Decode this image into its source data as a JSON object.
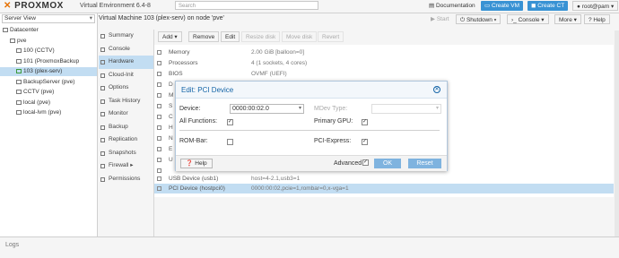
{
  "header": {
    "logo": "PROXMOX",
    "version": "Virtual Environment 6.4-8",
    "search_placeholder": "Search",
    "documentation": "Documentation",
    "create_vm": "Create VM",
    "create_ct": "Create CT",
    "user": "root@pam"
  },
  "tree": {
    "view": "Server View",
    "items": [
      {
        "label": "Datacenter"
      },
      {
        "label": "pve"
      },
      {
        "label": "100 (CCTV)"
      },
      {
        "label": "101 (ProxmoxBackup"
      },
      {
        "label": "103 (plex-serv)"
      },
      {
        "label": "BackupServer (pve)"
      },
      {
        "label": "CCTV (pve)"
      },
      {
        "label": "local (pve)"
      },
      {
        "label": "local-lvm (pve)"
      }
    ]
  },
  "vm": {
    "title": "Virtual Machine 103 (plex-serv) on node 'pve'",
    "actions": {
      "start": "Start",
      "shutdown": "Shutdown",
      "console": "Console",
      "more": "More",
      "help": "Help"
    }
  },
  "nav": {
    "items": [
      "Summary",
      "Console",
      "Hardware",
      "Cloud-Init",
      "Options",
      "Task History",
      "Monitor",
      "Backup",
      "Replication",
      "Snapshots",
      "Firewall",
      "Permissions"
    ]
  },
  "toolbar": {
    "add": "Add",
    "remove": "Remove",
    "edit": "Edit",
    "resize": "Resize disk",
    "move": "Move disk",
    "revert": "Revert"
  },
  "hardware": {
    "rows": [
      {
        "name": "Memory",
        "value": "2.00 GiB [balloon=0]"
      },
      {
        "name": "Processors",
        "value": "4 (1 sockets, 4 cores)"
      },
      {
        "name": "BIOS",
        "value": "OVMF (UEFI)"
      },
      {
        "name": "D",
        "value": ""
      },
      {
        "name": "M",
        "value": ""
      },
      {
        "name": "S",
        "value": ""
      },
      {
        "name": "C",
        "value": ""
      },
      {
        "name": "H",
        "value": ""
      },
      {
        "name": "N",
        "value": ""
      },
      {
        "name": "E",
        "value": ""
      },
      {
        "name": "U",
        "value": ""
      },
      {
        "name": "",
        "value": ""
      },
      {
        "name": "USB Device (usb1)",
        "value": "host=4-2.1,usb3=1"
      },
      {
        "name": "PCI Device (hostpci0)",
        "value": "0000:00:02,pcie=1,rombar=0,x-vga=1"
      }
    ]
  },
  "dialog": {
    "title": "Edit: PCI Device",
    "device_label": "Device:",
    "device_value": "0000:00:02.0",
    "mdev_label": "MDev Type:",
    "all_functions_label": "All Functions:",
    "primary_gpu_label": "Primary GPU:",
    "rombar_label": "ROM-Bar:",
    "pcie_label": "PCI-Express:",
    "help": "Help",
    "advanced": "Advanced",
    "ok": "OK",
    "reset": "Reset"
  },
  "logs": "Logs"
}
